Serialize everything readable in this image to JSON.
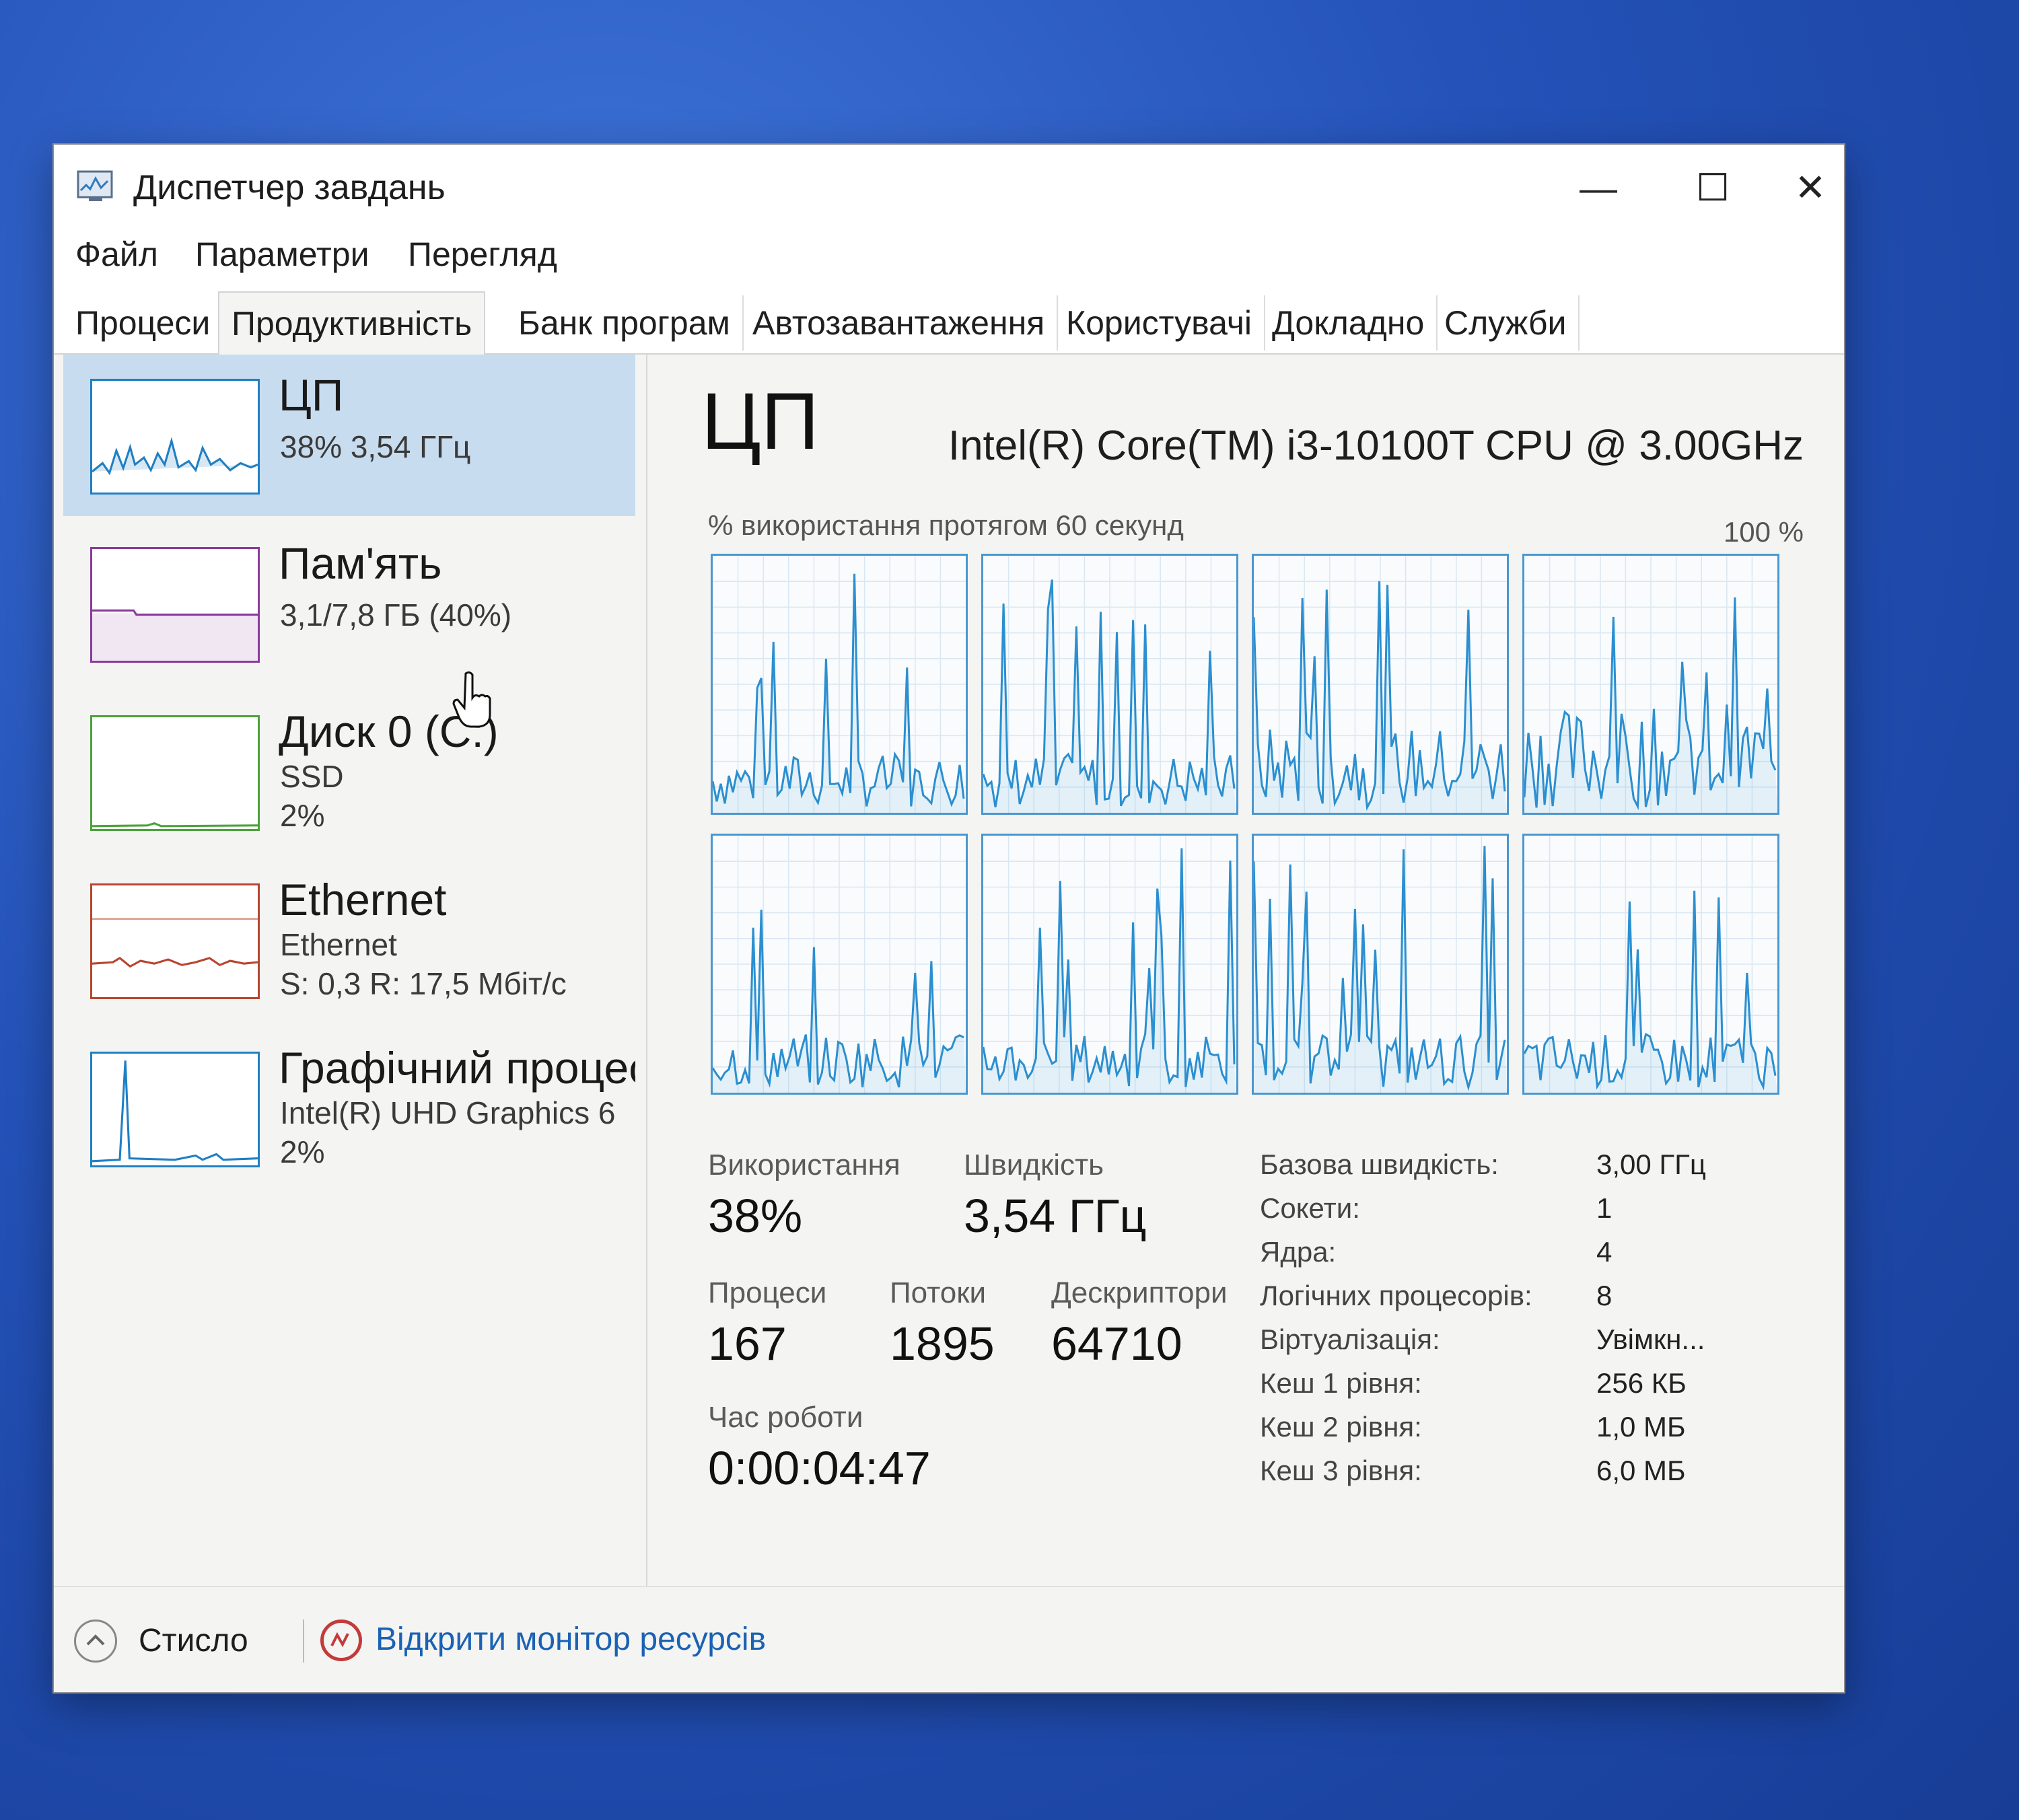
{
  "window": {
    "title": "Диспетчер завдань"
  },
  "menu": [
    "Файл",
    "Параметри",
    "Перегляд"
  ],
  "tabs": [
    "Процеси",
    "Продуктивність",
    "Банк програм",
    "Автозавантаження",
    "Користувачі",
    "Докладно",
    "Служби"
  ],
  "active_tab": "Продуктивність",
  "sidebar": {
    "items": [
      {
        "title": "ЦП",
        "lines": [
          "38% 3,54 ГГц"
        ],
        "color": "#1f7fc4",
        "selected": true
      },
      {
        "title": "Пам'ять",
        "lines": [
          "3,1/7,8 ГБ (40%)"
        ],
        "color": "#8b3a9e",
        "selected": false
      },
      {
        "title": "Диск 0 (C:)",
        "lines": [
          "SSD",
          "2%"
        ],
        "color": "#4aa33a",
        "selected": false
      },
      {
        "title": "Ethernet",
        "lines": [
          "Ethernet",
          "S: 0,3 R: 17,5 Мбіт/с"
        ],
        "color": "#b8452e",
        "selected": false
      },
      {
        "title": "Графічний процес",
        "lines": [
          "Intel(R) UHD Graphics 6",
          "2%"
        ],
        "color": "#1f7fc4",
        "selected": false
      }
    ]
  },
  "cpu": {
    "heading": "ЦП",
    "model": "Intel(R) Core(TM) i3-10100T CPU @ 3.00GHz",
    "graph_label": "% використання протягом 60 секунд",
    "graph_max": "100 %",
    "graph_color": "#2b8fd0",
    "logical_cores": 8
  },
  "stats": {
    "usage": {
      "label": "Використання",
      "value": "38%"
    },
    "speed": {
      "label": "Швидкість",
      "value": "3,54 ГГц"
    },
    "processes": {
      "label": "Процеси",
      "value": "167"
    },
    "threads": {
      "label": "Потоки",
      "value": "1895"
    },
    "handles": {
      "label": "Дескриптори",
      "value": "64710"
    },
    "uptime": {
      "label": "Час роботи",
      "value": "0:00:04:47"
    }
  },
  "specs": [
    {
      "label": "Базова швидкість:",
      "value": "3,00 ГГц"
    },
    {
      "label": "Сокети:",
      "value": "1"
    },
    {
      "label": "Ядра:",
      "value": "4"
    },
    {
      "label": "Логічних процесорів:",
      "value": "8"
    },
    {
      "label": "Віртуалізація:",
      "value": "Увімкн..."
    },
    {
      "label": "Кеш 1 рівня:",
      "value": "256 КБ"
    },
    {
      "label": "Кеш 2 рівня:",
      "value": "1,0 МБ"
    },
    {
      "label": "Кеш 3 рівня:",
      "value": "6,0 МБ"
    }
  ],
  "footer": {
    "collapse": "Стисло",
    "monitor_link": "Відкрити монітор ресурсів"
  }
}
